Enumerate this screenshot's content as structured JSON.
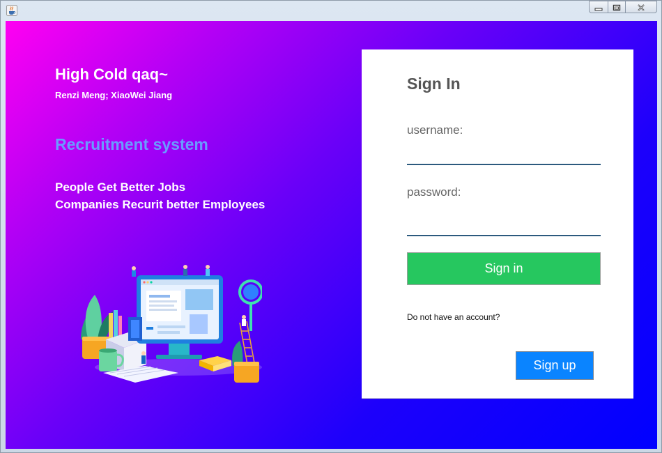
{
  "window": {
    "icon": "java-cup-icon",
    "controls": [
      "minimize-icon",
      "maximize-icon",
      "close-icon"
    ]
  },
  "branding": {
    "title": "High Cold qaq~",
    "authors": "Renzi Meng; XiaoWei Jiang",
    "system_name": "Recruitment system",
    "slogan_line1": "People Get Better Jobs",
    "slogan_line2": "Companies Recurit better Employees",
    "illustration": "recruitment-illustration"
  },
  "signin": {
    "heading": "Sign In",
    "username_label": "username:",
    "username_value": "",
    "password_label": "password:",
    "password_value": "",
    "signin_button": "Sign in",
    "account_question": "Do not have an account?",
    "signup_button": "Sign up"
  },
  "colors": {
    "gradient_start": "#ff00f2",
    "gradient_end": "#0000ff",
    "system_name": "#6a9bff",
    "signin_button": "#26c75f",
    "signup_button": "#0a84ff",
    "field_underline": "#2c5a7e"
  }
}
